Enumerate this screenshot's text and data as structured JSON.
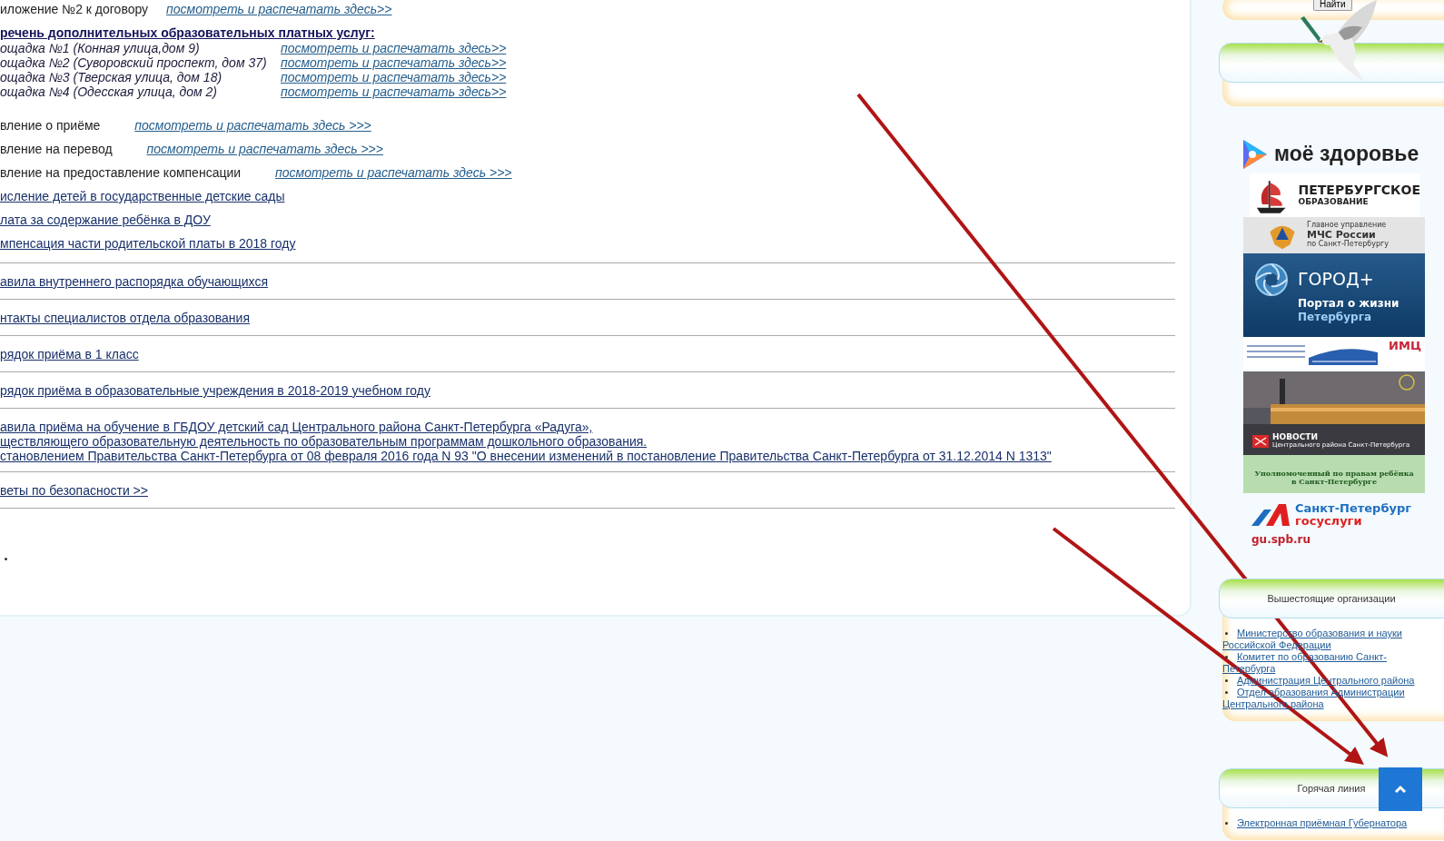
{
  "top_items": [
    {
      "kind": "doc",
      "label": "иложение №2 к договору",
      "link": "посмотреть и распечатать здесь>>"
    },
    {
      "kind": "heading",
      "label": "речень дополнительных образовательных платных услуг:"
    },
    {
      "kind": "venue",
      "label": "ощадка №1 (Конная улица,дом 9)",
      "link": "посмотреть и распечатать здесь>>"
    },
    {
      "kind": "venue",
      "label": "ощадка №2 (Суворовский проспект, дом 37)",
      "link": "посмотреть и распечатать здесь>>"
    },
    {
      "kind": "venue",
      "label": "ощадка №3 (Тверская улица, дом 18)",
      "link": "посмотреть и распечатать здесь>>"
    },
    {
      "kind": "venue",
      "label": "ощадка №4 (Одесская улица, дом 2)",
      "link": "посмотреть и распечатать здесь>>"
    },
    {
      "kind": "doc",
      "label": "вление о приёме",
      "link": "посмотреть и распечатать здесь >>>"
    },
    {
      "kind": "doc",
      "label": "вление на перевод",
      "link": "посмотреть и распечатать здесь >>>"
    },
    {
      "kind": "doc",
      "label": "вление на предоставление компенсации",
      "link": "посмотреть и распечатать здесь >>>"
    },
    {
      "kind": "link",
      "label": "исление детей в государственные детские сады"
    },
    {
      "kind": "link",
      "label": "лата за содержание ребёнка в ДОУ"
    },
    {
      "kind": "link",
      "label": "мпенсация части родительской платы в 2018 году"
    }
  ],
  "sections": [
    {
      "lines": [
        "авила внутреннего распорядка обучающихся"
      ]
    },
    {
      "lines": [
        "нтакты специалистов отдела образования"
      ]
    },
    {
      "lines": [
        "рядок приёма в 1 класс"
      ]
    },
    {
      "lines": [
        "рядок приёма в образовательные учреждения в 2018-2019 учебном году"
      ]
    },
    {
      "lines": [
        "авила приёма на обучение в ГБДОУ детский сад Центрального района Санкт-Петербурга «Радуга»,",
        "ществляющего образовательную деятельность по образовательным программам дошкольного образования.",
        "становлением Правительства Санкт-Петербурга от 08 февраля 2016 года N 93 \"О внесении изменений в постановление Правительства Санкт-Петербурга от 31.12.2014 N 1313\""
      ]
    },
    {
      "lines": [
        "веты по безопасности >>"
      ]
    }
  ],
  "sidebar": {
    "search_button": "Найти",
    "banners": [
      {
        "kind": "health",
        "lines": [
          "моё здоровье"
        ]
      },
      {
        "kind": "education",
        "lines": [
          "ПЕТЕРБУРГСКОЕ",
          "ОБРАЗОВАНИЕ"
        ]
      },
      {
        "kind": "mchs",
        "lines": [
          "Главное управление",
          "МЧС России",
          "по Санкт-Петербургу"
        ]
      },
      {
        "kind": "gorod",
        "lines": [
          "ГОРОД+",
          "Портал о жизни",
          "Петербурга"
        ]
      },
      {
        "kind": "imc",
        "lines": [
          "ИМЦ"
        ]
      },
      {
        "kind": "news",
        "lines": [
          "НОВОСТИ",
          "Центрального района Санкт-Петербурга"
        ]
      },
      {
        "kind": "ombudsman",
        "lines": [
          "Уполномоченный по правам ребёнка",
          "в Санкт-Петербурге"
        ]
      },
      {
        "kind": "gosuslugi",
        "lines": [
          "Санкт-Петербург",
          "госуслуги",
          "gu.spb.ru"
        ]
      }
    ],
    "org_card": {
      "title": "Вышестоящие организации",
      "links": [
        "Министерство образования и науки Российской Федерации",
        "Комитет по образованию Санкт-Петербурга",
        "Администрация Центрального района",
        "Отдел образования Администрации Центрального района"
      ]
    },
    "hotline_card": {
      "title": "Горячая линия",
      "links": [
        "Электронная приёмная Губернатора"
      ]
    }
  }
}
